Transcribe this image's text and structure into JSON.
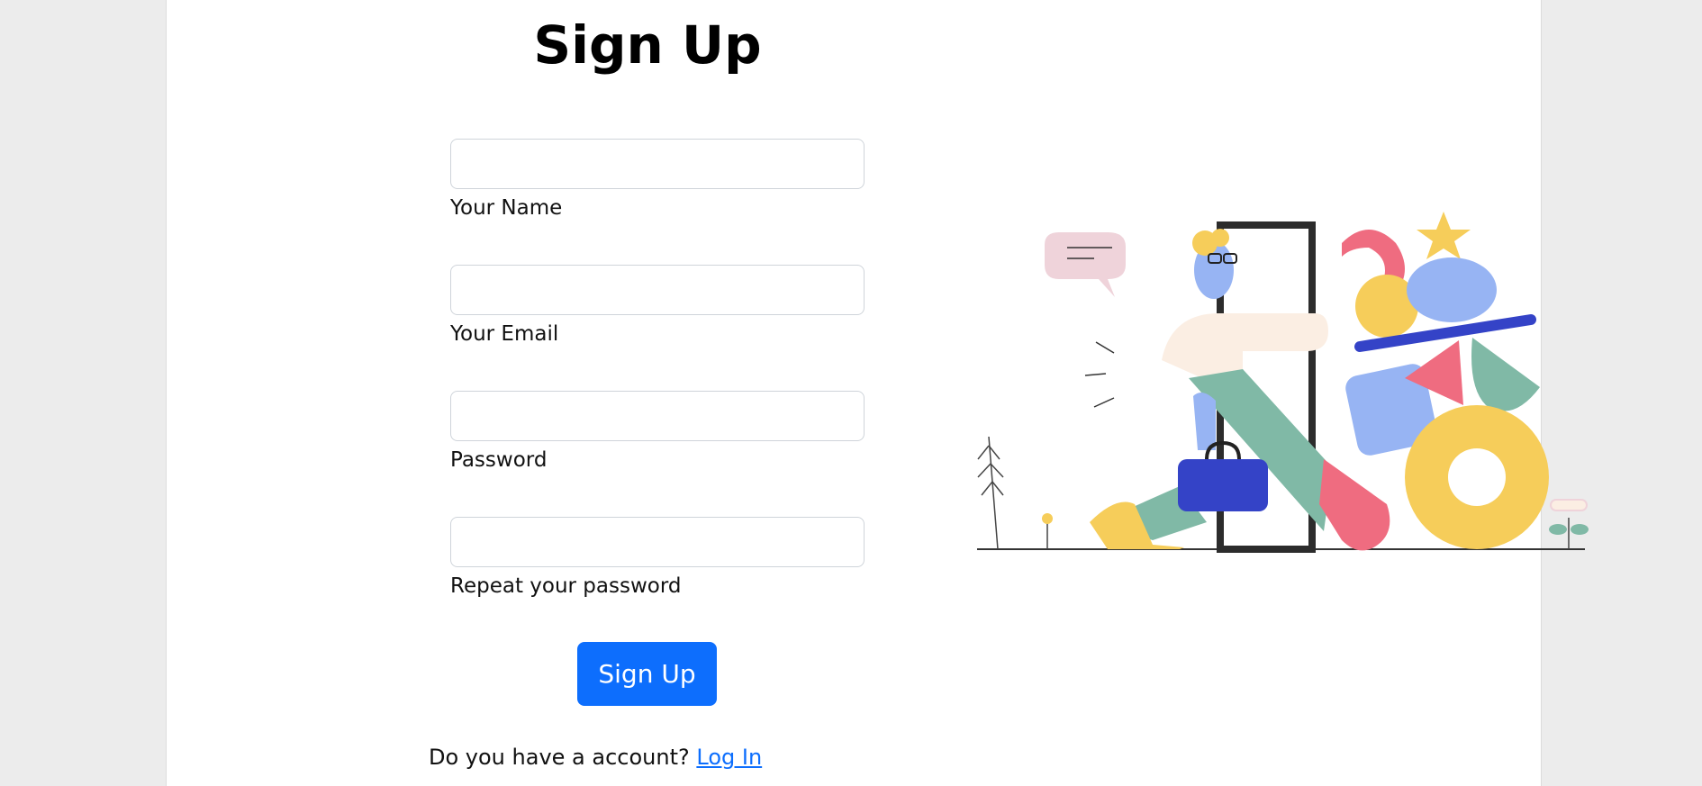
{
  "page": {
    "title": "Sign Up"
  },
  "form": {
    "fields": [
      {
        "label": "Your Name",
        "value": "",
        "placeholder": ""
      },
      {
        "label": "Your Email",
        "value": "",
        "placeholder": ""
      },
      {
        "label": "Password",
        "value": "",
        "placeholder": ""
      },
      {
        "label": "Repeat your password",
        "value": "",
        "placeholder": ""
      }
    ],
    "submit_label": "Sign Up"
  },
  "footer": {
    "prompt": "Do you have a account?",
    "login_link": "Log In"
  },
  "colors": {
    "accent": "#0d6efd",
    "background": "#ececec",
    "card": "#ffffff"
  },
  "illustration": {
    "icon": "person-walking-through-door-with-shapes-illustration"
  }
}
